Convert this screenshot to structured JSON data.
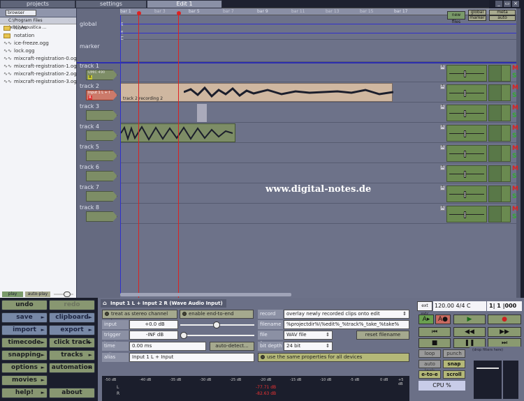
{
  "tabs": {
    "projects": "projects",
    "settings": "settings",
    "edit": "Edit 1"
  },
  "browser": {
    "select": "browser",
    "path": "C:\\Program Files (x86)\\Acoustica ...",
    "items": [
      "icons",
      "notation",
      "ice-freeze.ogg",
      "lock.ogg",
      "mixcraft-registration-0.og",
      "mixcraft-registration-1.og",
      "mixcraft-registration-2.og",
      "mixcraft-registration-3.og"
    ],
    "play": "play",
    "autoplay": "auto-play"
  },
  "buttons": {
    "undo": "undo",
    "redo": "redo",
    "save": "save",
    "clipboard": "clipboard",
    "import": "import",
    "export": "export",
    "timecode": "timecode",
    "click_track": "click track",
    "snapping": "snapping",
    "tracks": "tracks",
    "options": "options",
    "automation": "automation",
    "movies": "movies",
    "help": "help!",
    "about": "about"
  },
  "ruler": {
    "bars": [
      "bar 1",
      "bar 3",
      "bar 5",
      "bar 7",
      "bar 9",
      "bar 11",
      "bar 13",
      "bar 15",
      "bar 17"
    ],
    "new_files": "new files",
    "global": "global",
    "marker": "marker",
    "meta": "meta",
    "auto": "auto"
  },
  "tracks": {
    "global": "global",
    "marker": "marker",
    "names": [
      "track 1",
      "track 2",
      "track 3",
      "track 4",
      "track 5",
      "track 6",
      "track 7",
      "track 8"
    ],
    "global_values": [
      "4",
      "4",
      "C"
    ],
    "track1_label": "UMIC 490",
    "track2_label": "Input 1 L + I",
    "clip": "track 2 recording 2"
  },
  "watermark": "www.digital-notes.de",
  "panel": {
    "title": "Input 1 L + Input 2 R (Wave Audio Input)",
    "stereo": "treat as stereo channel pair",
    "end_to_end": "enable end-to-end",
    "input_gain_label": "input gain",
    "input_gain": "+0.0 dB",
    "trigger_label": "trigger level",
    "trigger": "-INF dB",
    "time_adjust_label": "time adjust",
    "time_adjust": "0.00 ms",
    "auto_detect": "auto-detect...",
    "alias_label": "alias",
    "alias": "Input 1 L + Input",
    "record_mode_label": "record mode",
    "record_mode": "overlay newly recorded clips onto edit",
    "filename_label": "filename",
    "filename": "%projectdir%\\%edit%_%track%_take_%take%",
    "format_label": "file format",
    "format": "WAV file",
    "reset": "reset filename",
    "bit_label": "bit depth",
    "bit": "24 bit",
    "same_props": "use the same properties for all devices",
    "meter_scale": [
      "-50 dB",
      "-40 dB",
      "-35 dB",
      "-30 dB",
      "-25 dB",
      "-20 dB",
      "-15 dB",
      "-10 dB",
      "-5 dB",
      "0 dB",
      "+5 dB"
    ],
    "meter_l": "-77.71 dB",
    "meter_r": "-82.63 dB"
  },
  "transport": {
    "ext": "ext mtc",
    "tempo": "120.00 4/4  C",
    "position": "1|  1 |000",
    "loop": "loop",
    "punch": "punch",
    "autolock": "auto lock",
    "snap": "snap",
    "eto": "e-to-e",
    "scroll": "scroll",
    "cpu": "CPU %",
    "drop": "(drop filters here)"
  }
}
